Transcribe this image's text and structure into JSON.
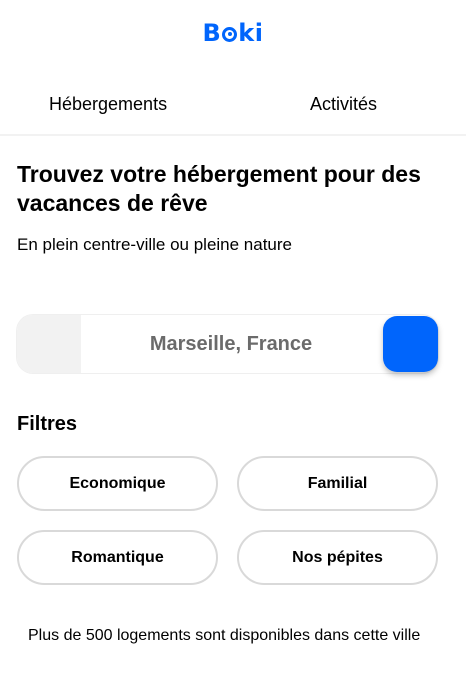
{
  "brand": {
    "name_left": "B",
    "name_right": "ki",
    "color": "#0065fc"
  },
  "nav": {
    "tabs": [
      {
        "label": "Hébergements"
      },
      {
        "label": "Activités"
      }
    ]
  },
  "hero": {
    "title": "Trouvez votre hébergement pour des vacances de rêve",
    "subtitle": "En plein centre-ville ou pleine nature"
  },
  "search": {
    "placeholder": "Marseille, France",
    "value": "",
    "button_color": "#0065fc"
  },
  "filters": {
    "title": "Filtres",
    "items": [
      {
        "label": "Economique"
      },
      {
        "label": "Familial"
      },
      {
        "label": "Romantique"
      },
      {
        "label": "Nos pépites"
      }
    ]
  },
  "results": {
    "availability_text": "Plus de 500 logements sont disponibles dans cette ville"
  }
}
